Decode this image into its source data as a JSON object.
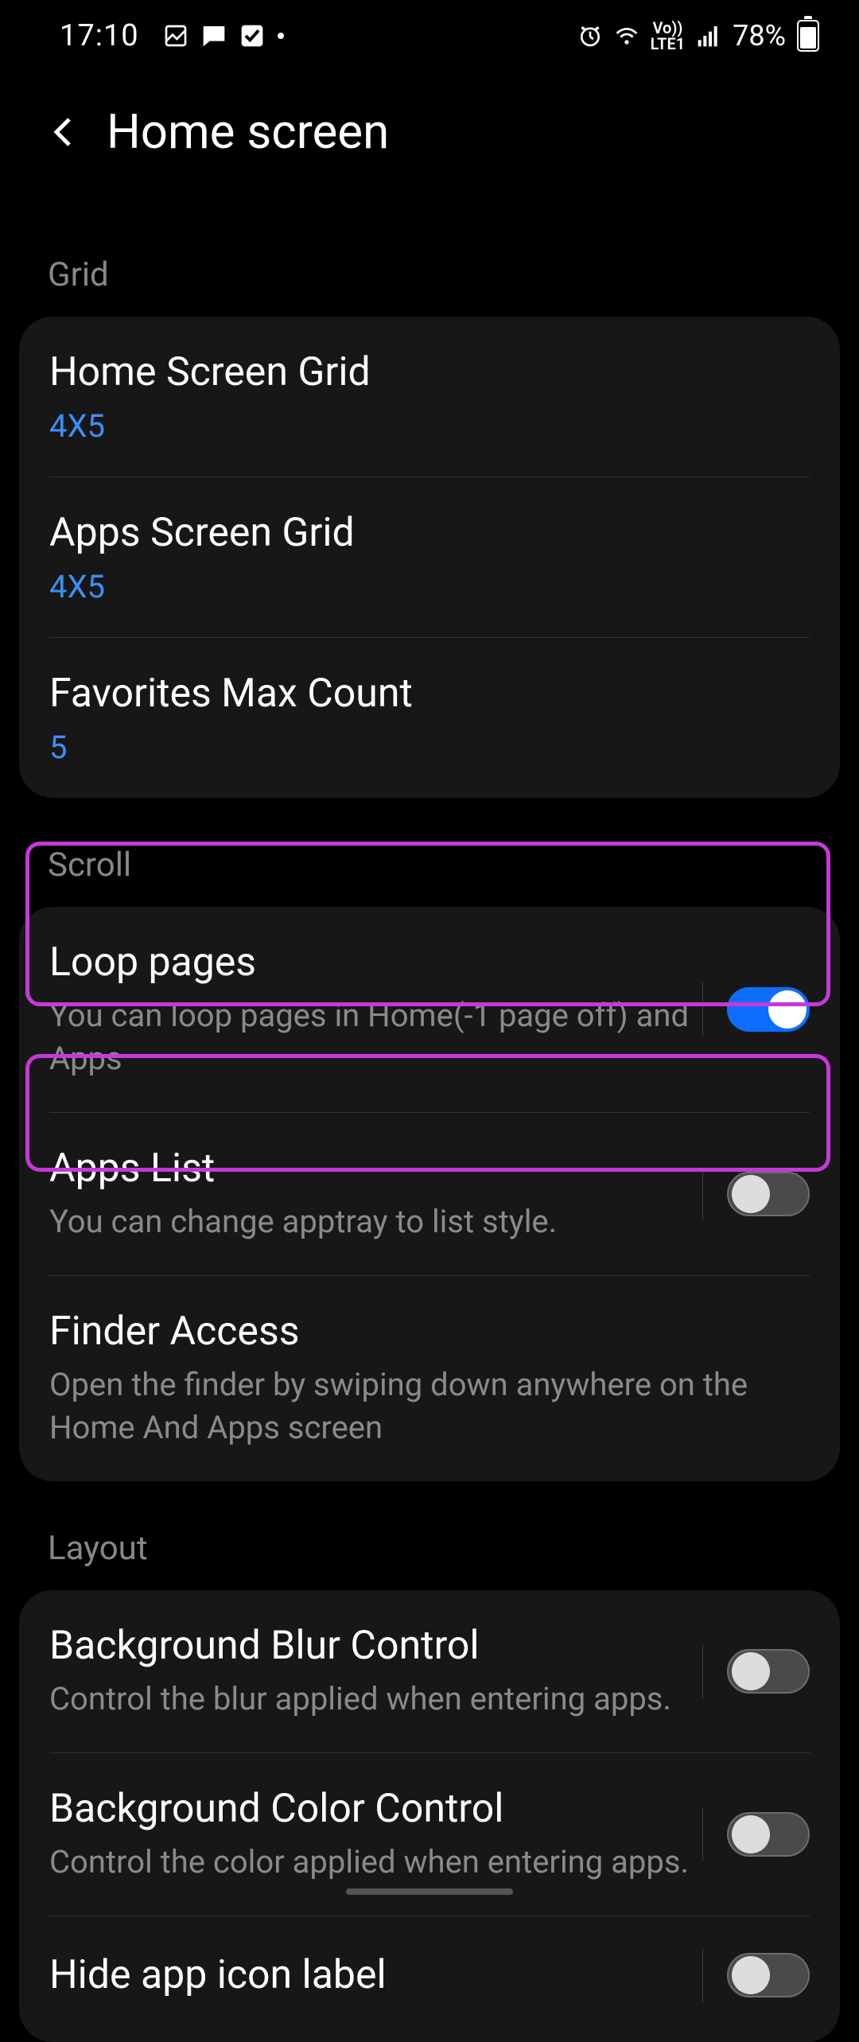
{
  "statusbar": {
    "time": "17:10",
    "battery": "78%"
  },
  "header": {
    "title": "Home screen"
  },
  "sections": {
    "grid": {
      "label": "Grid",
      "items": [
        {
          "title": "Home Screen Grid",
          "value": "4X5"
        },
        {
          "title": "Apps Screen Grid",
          "value": "4X5"
        },
        {
          "title": "Favorites Max Count",
          "value": "5"
        }
      ]
    },
    "scroll": {
      "label": "Scroll",
      "items": [
        {
          "title": "Loop pages",
          "description": "You can loop pages in Home(-1 page off) and Apps",
          "toggle": true
        },
        {
          "title": "Apps List",
          "description": "You can change apptray to list style.",
          "toggle": false
        },
        {
          "title": "Finder Access",
          "description": "Open the finder by swiping down anywhere on the Home And Apps screen"
        }
      ]
    },
    "layout": {
      "label": "Layout",
      "items": [
        {
          "title": "Background Blur Control",
          "description": "Control the blur applied when entering apps.",
          "toggle": false
        },
        {
          "title": "Background Color Control",
          "description": "Control the color applied when entering apps.",
          "toggle": false
        },
        {
          "title": "Hide app icon label",
          "toggle": false
        }
      ]
    }
  }
}
